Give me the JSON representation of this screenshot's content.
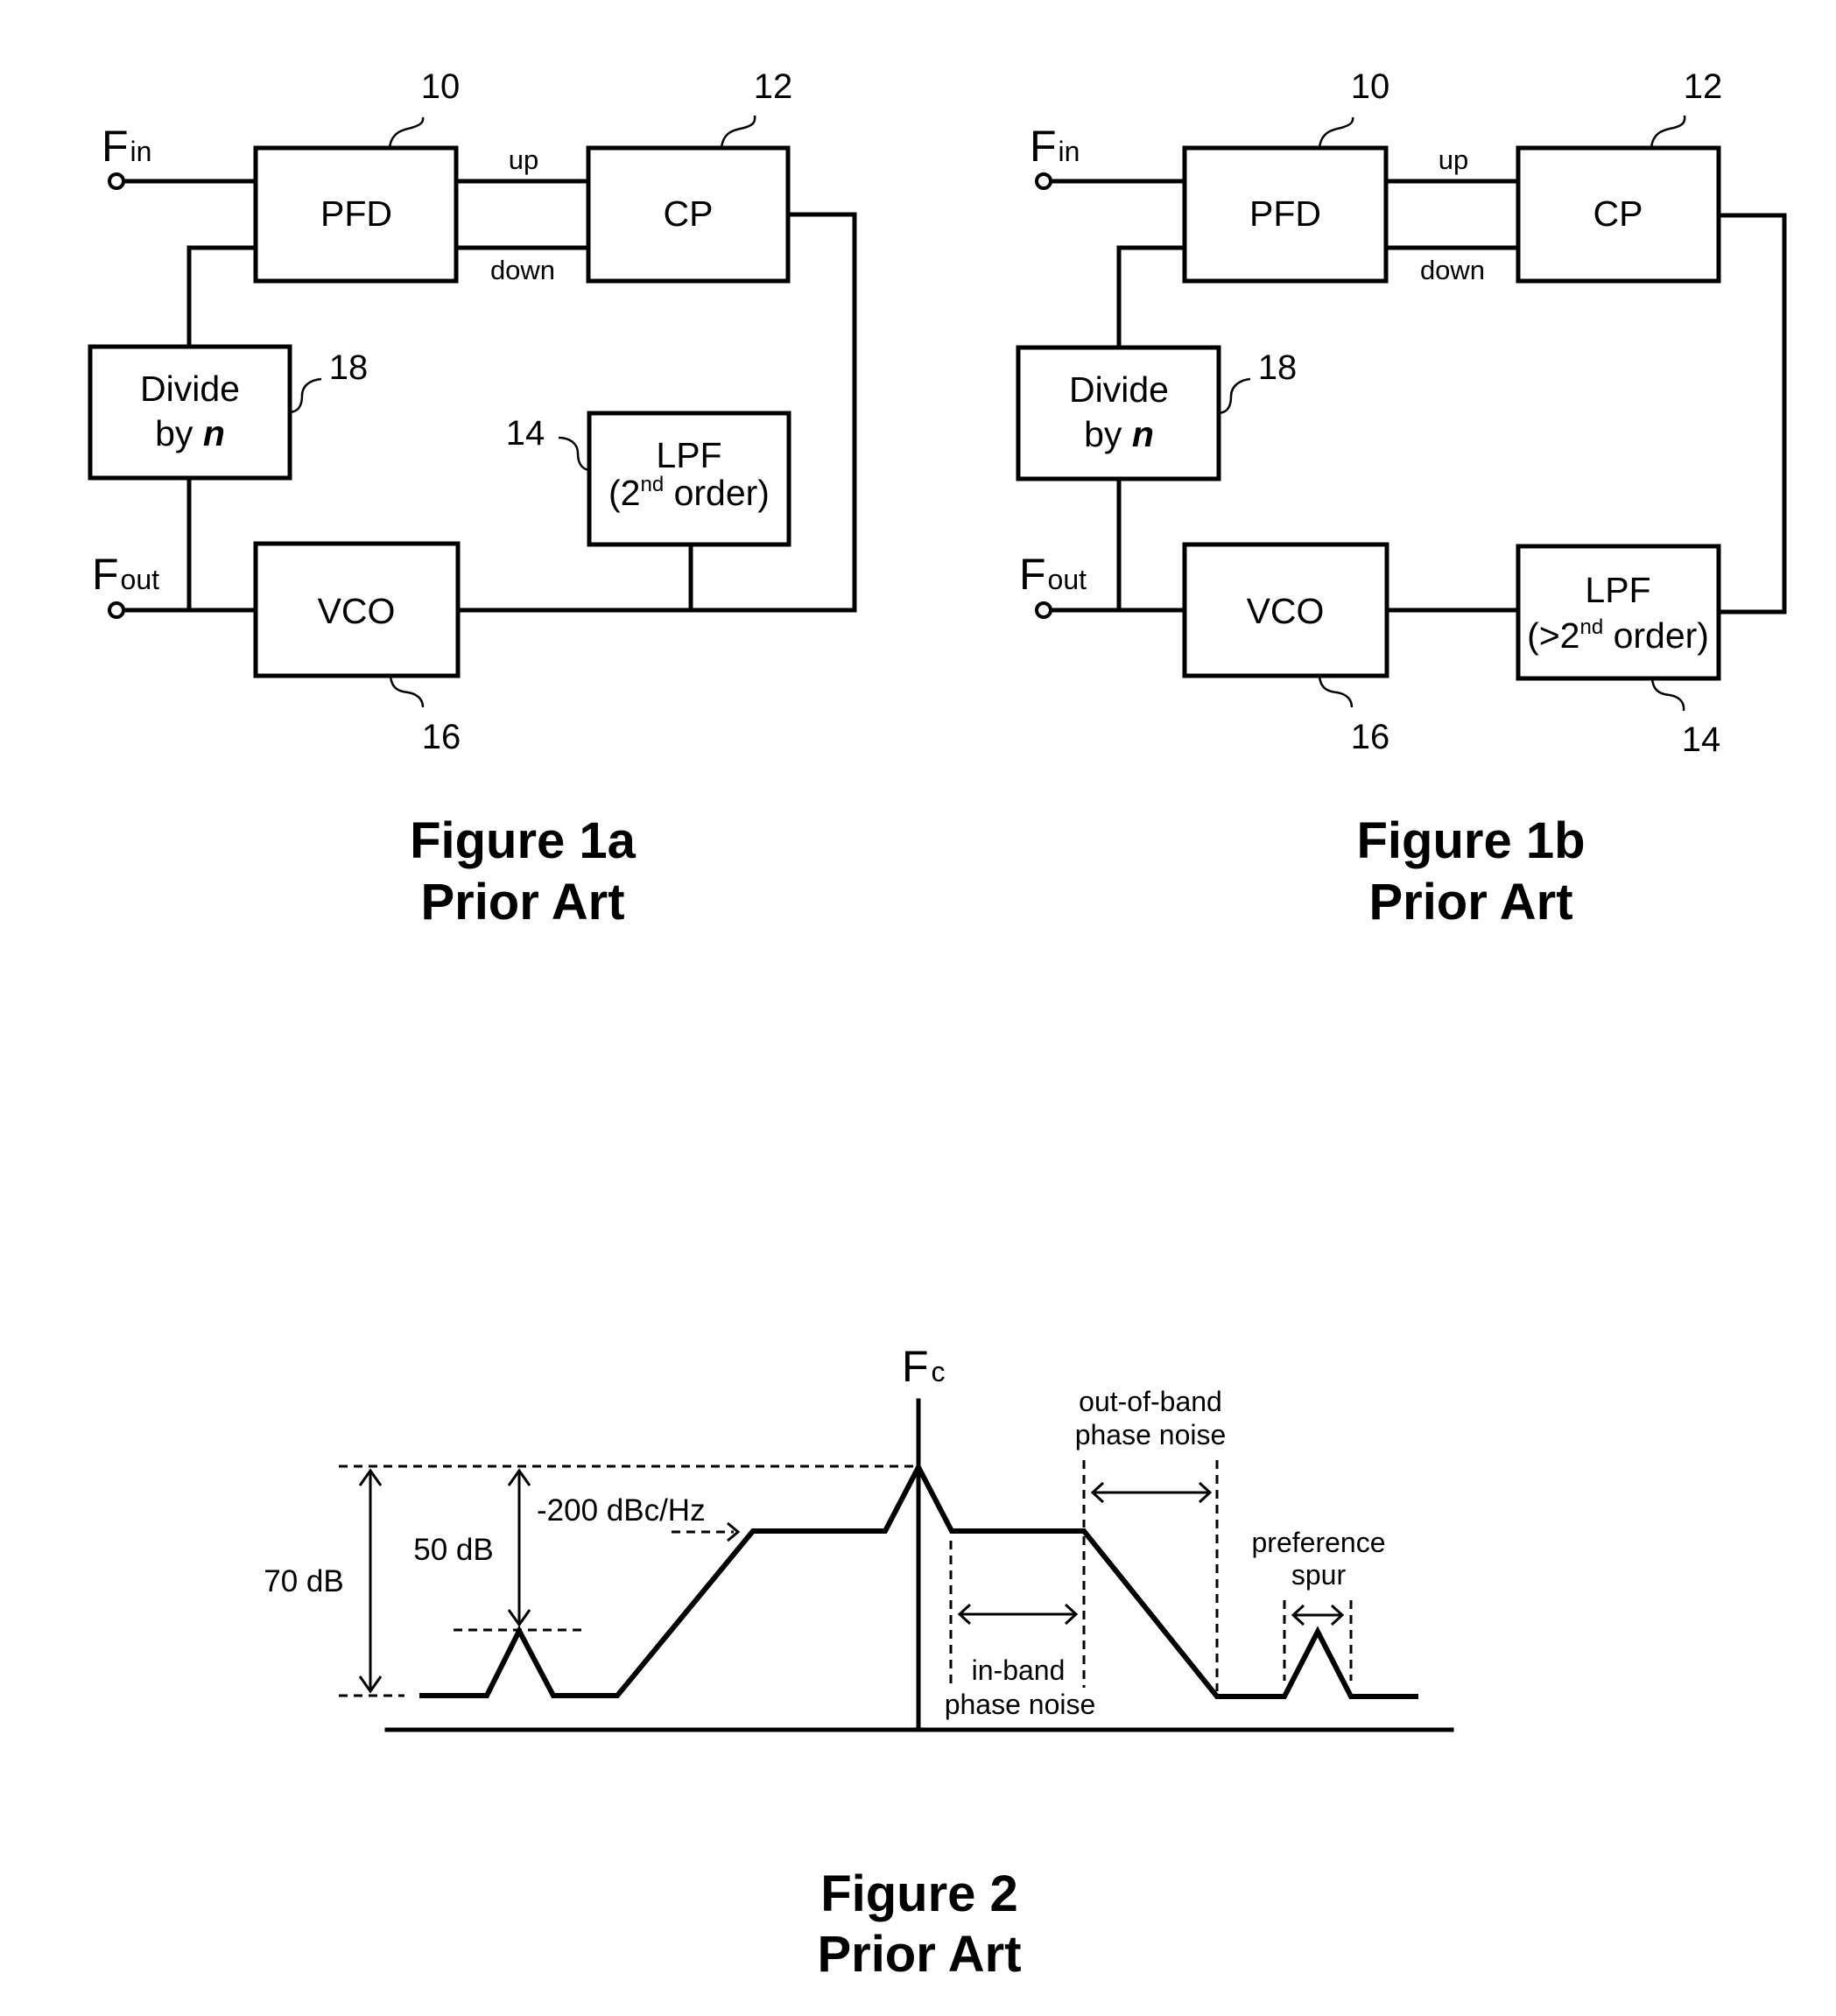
{
  "figures": [
    {
      "id": "fig1a",
      "caption": {
        "line1": "Figure 1a",
        "line2": "Prior Art"
      },
      "input_label": {
        "main": "F",
        "sub": "in"
      },
      "output_label": {
        "main": "F",
        "sub": "out"
      },
      "signals": {
        "up": "up",
        "down": "down"
      },
      "blocks": {
        "pfd": {
          "label": "PFD",
          "ref": "10"
        },
        "cp": {
          "label": "CP",
          "ref": "12"
        },
        "lpf": {
          "line1": "LPF",
          "line2_pre": "(2",
          "line2_sup": "nd",
          "line2_post": " order)",
          "ref": "14"
        },
        "vco": {
          "label": "VCO",
          "ref": "16"
        },
        "divider": {
          "line1": "Divide",
          "line2_pre": "by ",
          "line2_var": "n",
          "ref": "18"
        }
      }
    },
    {
      "id": "fig1b",
      "caption": {
        "line1": "Figure 1b",
        "line2": "Prior Art"
      },
      "input_label": {
        "main": "F",
        "sub": "in"
      },
      "output_label": {
        "main": "F",
        "sub": "out"
      },
      "signals": {
        "up": "up",
        "down": "down"
      },
      "blocks": {
        "pfd": {
          "label": "PFD",
          "ref": "10"
        },
        "cp": {
          "label": "CP",
          "ref": "12"
        },
        "lpf": {
          "line1": "LPF",
          "line2_pre": "(>2",
          "line2_sup": "nd",
          "line2_post": " order)",
          "ref": "14"
        },
        "vco": {
          "label": "VCO",
          "ref": "16"
        },
        "divider": {
          "line1": "Divide",
          "line2_pre": "by ",
          "line2_var": "n",
          "ref": "18"
        }
      }
    }
  ],
  "spectrum": {
    "caption": {
      "line1": "Figure 2",
      "line2": "Prior Art"
    },
    "carrier_label": {
      "main": "F",
      "sub": "c"
    },
    "annotations": {
      "total_range": "70 dB",
      "spur_rejection": "50 dB",
      "noise_level": "-200 dBc/Hz",
      "in_band": {
        "line1": "in-band",
        "line2": "phase noise"
      },
      "out_of_band": {
        "line1": "out-of-band",
        "line2": "phase noise"
      },
      "reference_spur": {
        "line1": "preference",
        "line2": "spur"
      }
    }
  }
}
